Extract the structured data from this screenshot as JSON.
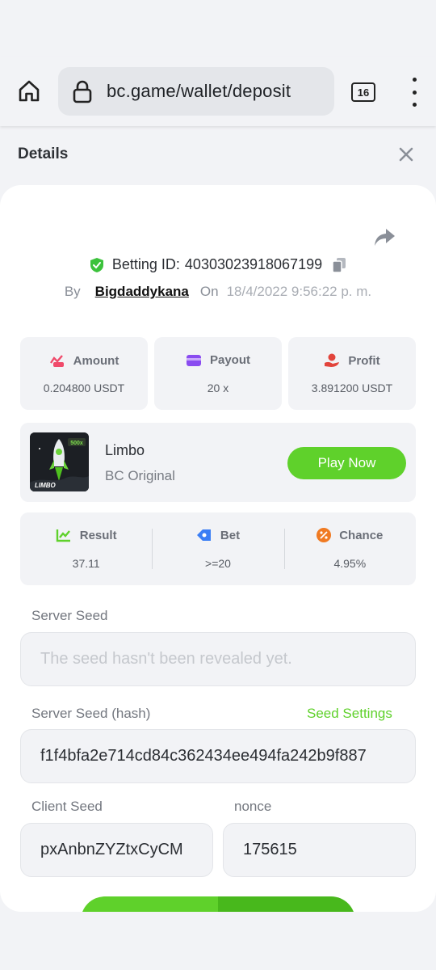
{
  "browser": {
    "url": "bc.game/wallet/deposit",
    "tab_count": "16"
  },
  "details": {
    "title": "Details"
  },
  "bet": {
    "betting_id_label": "Betting ID:",
    "betting_id": "40303023918067199",
    "by_label": "By",
    "username": "Bigdaddykana",
    "on_label": "On",
    "date": "18/4/2022 9:56:22 p. m."
  },
  "stats": {
    "amount_label": "Amount",
    "amount_value": "0.204800 USDT",
    "payout_label": "Payout",
    "payout_value": "20 x",
    "profit_label": "Profit",
    "profit_value": "3.891200 USDT"
  },
  "game": {
    "name": "Limbo",
    "subtitle": "BC Original",
    "thumb_badge": "500x",
    "thumb_label": "LIMBO",
    "play_label": "Play Now"
  },
  "result": {
    "result_label": "Result",
    "result_value": "37.11",
    "bet_label": "Bet",
    "bet_value": ">=20",
    "chance_label": "Chance",
    "chance_value": "4.95%"
  },
  "seeds": {
    "server_seed_label": "Server Seed",
    "server_seed_placeholder": "The seed hasn't been revealed yet.",
    "server_hash_label": "Server Seed (hash)",
    "seed_settings_label": "Seed Settings",
    "server_hash_value": "f1f4bfa2e714cd84c362434ee494fa242b9f887",
    "client_seed_label": "Client Seed",
    "client_seed_value": "pxAnbnZYZtxCyCM",
    "nonce_label": "nonce",
    "nonce_value": "175615"
  },
  "colors": {
    "accent_green": "#5fd12b",
    "shield_green": "#3cc23c",
    "amount_pink": "#f04a6b",
    "payout_purple": "#8a4cf0",
    "profit_red": "#e2443c",
    "bet_blue": "#3a7ef5",
    "chance_orange": "#f07a22"
  }
}
